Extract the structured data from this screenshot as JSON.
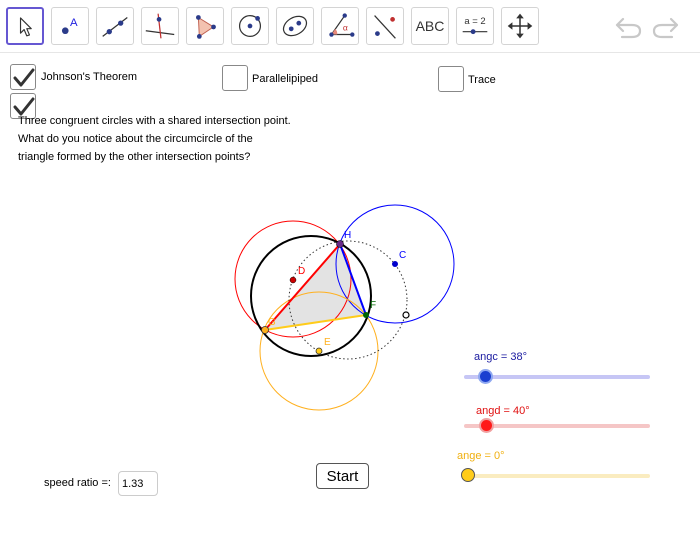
{
  "toolbar": {
    "tools": [
      {
        "name": "move-tool-button",
        "icon": "arrow-cursor-icon"
      },
      {
        "name": "point-tool-button",
        "icon": "point-icon",
        "label": "A"
      },
      {
        "name": "line-tool-button",
        "icon": "line-icon"
      },
      {
        "name": "perpendicular-tool-button",
        "icon": "perpendicular-line-icon"
      },
      {
        "name": "polygon-tool-button",
        "icon": "polygon-icon"
      },
      {
        "name": "circle-tool-button",
        "icon": "circle-center-point-icon"
      },
      {
        "name": "ellipse-tool-button",
        "icon": "ellipse-icon"
      },
      {
        "name": "angle-tool-button",
        "icon": "angle-icon",
        "label": "α"
      },
      {
        "name": "reflect-tool-button",
        "icon": "reflect-line-icon"
      },
      {
        "name": "text-tool-button",
        "icon": "text-icon",
        "label": "ABC"
      },
      {
        "name": "slider-tool-button",
        "icon": "slider-icon",
        "label": "a = 2"
      },
      {
        "name": "move-view-tool-button",
        "icon": "move-graphics-view-icon"
      }
    ],
    "undo_icon": "undo-icon",
    "redo_icon": "redo-icon"
  },
  "checkboxes": {
    "johnson": {
      "label": "Johnson's Theorem",
      "checked": true
    },
    "parallelepiped": {
      "label": "Parallelipiped",
      "checked": false
    },
    "trace": {
      "label": "Trace",
      "checked": false
    },
    "unlabeled": {
      "checked": true
    }
  },
  "description": {
    "line1": "Three congruent circles with a shared intersection point.",
    "line2": "What do you notice about the circumcircle of the",
    "line3": "triangle formed by the other intersection points?"
  },
  "construction": {
    "points": {
      "H": "H",
      "C": "C",
      "D": "D",
      "F": "F",
      "G": "G",
      "E": "E"
    },
    "colors": {
      "blue": "#0000ff",
      "red": "#ff0000",
      "orange": "#ffb01e",
      "green": "#006400",
      "purple": "#6a2a8a",
      "fill": "#d9d9d9",
      "black": "#000000"
    }
  },
  "sliders": {
    "angc": {
      "label": "angc = 38°",
      "value": 38,
      "color": "#1565c0",
      "track": "#c6c6f5"
    },
    "angd": {
      "label": "angd = 40°",
      "value": 40,
      "color": "#ff1a1a",
      "track": "#f5c6c6"
    },
    "ange": {
      "label": "ange = 0°",
      "value": 0,
      "color": "#ffcc1a",
      "track": "#faecc0"
    }
  },
  "start_button": "Start",
  "speed": {
    "label": "speed ratio =:",
    "value": "1.33"
  }
}
